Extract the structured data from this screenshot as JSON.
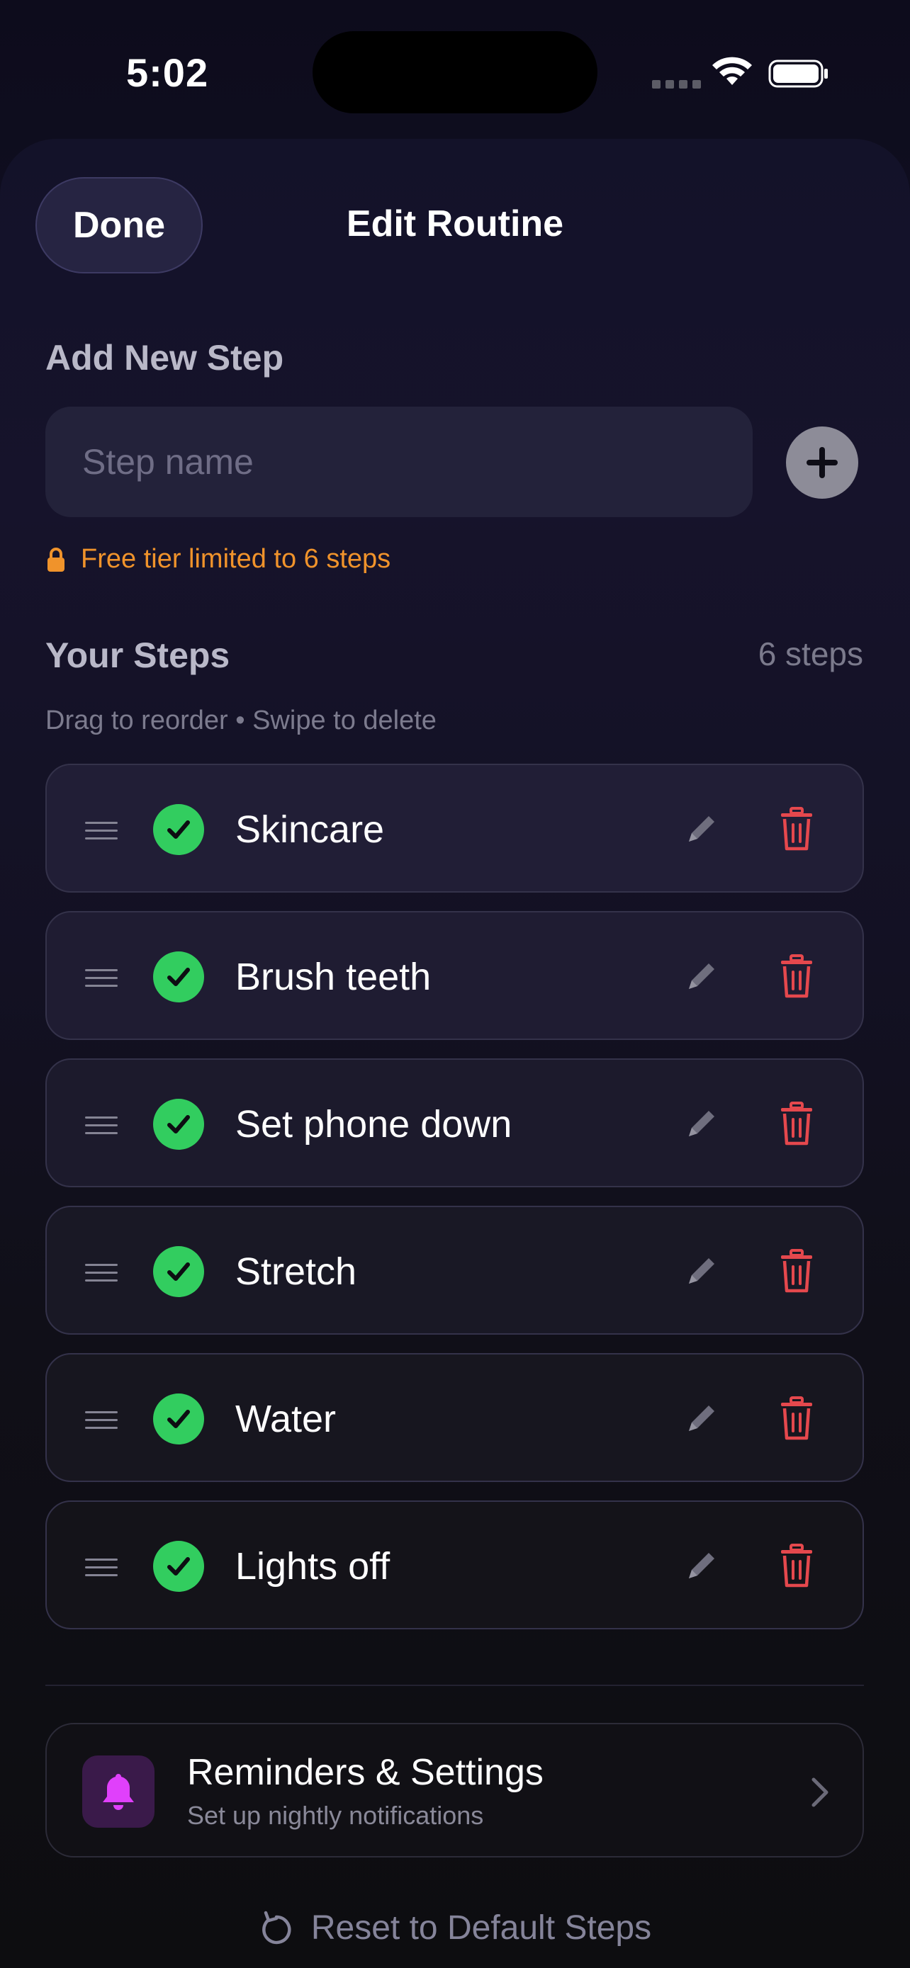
{
  "status_bar": {
    "time": "5:02"
  },
  "header": {
    "done_label": "Done",
    "title": "Edit Routine"
  },
  "add_step": {
    "section_title": "Add New Step",
    "placeholder": "Step name",
    "value": "",
    "limit_notice": "Free tier limited to 6 steps"
  },
  "steps_section": {
    "title": "Your Steps",
    "count_label": "6 steps",
    "hint": "Drag to reorder • Swipe to delete",
    "items": [
      {
        "name": "Skincare",
        "checked": true
      },
      {
        "name": "Brush teeth",
        "checked": true
      },
      {
        "name": "Set phone down",
        "checked": true
      },
      {
        "name": "Stretch",
        "checked": true
      },
      {
        "name": "Water",
        "checked": true
      },
      {
        "name": "Lights off",
        "checked": true
      }
    ]
  },
  "settings_link": {
    "title": "Reminders & Settings",
    "subtitle": "Set up nightly notifications"
  },
  "reset_label": "Reset to Default Steps",
  "colors": {
    "accent_orange": "#f0932b",
    "check_green": "#32cd5f",
    "delete_red": "#e5484d",
    "bell_magenta": "#e040fb"
  }
}
